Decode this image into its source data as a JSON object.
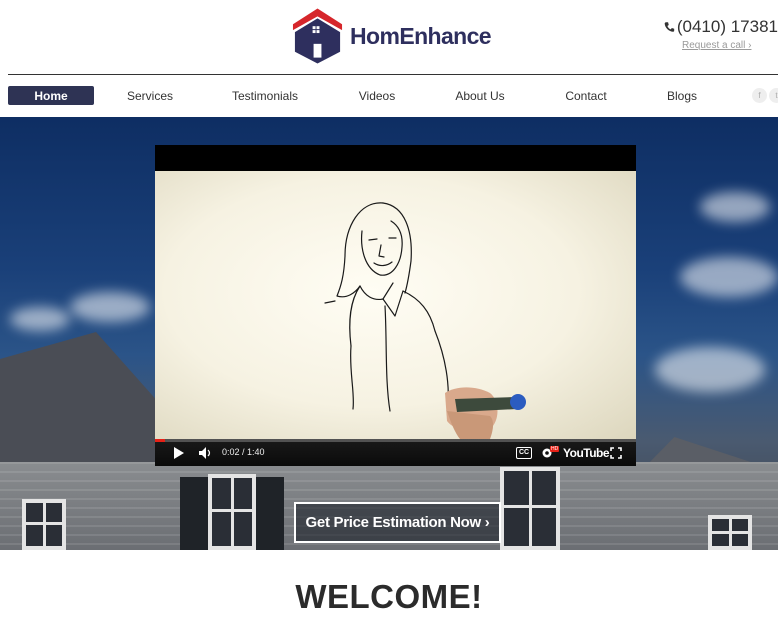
{
  "header": {
    "brand_name": "HomEnhance",
    "phone": "(0410) 17381",
    "request_call": "Request a call ›"
  },
  "nav": {
    "items": [
      {
        "label": "Home",
        "active": true
      },
      {
        "label": "Services"
      },
      {
        "label": "Testimonials"
      },
      {
        "label": "Videos"
      },
      {
        "label": "About Us"
      },
      {
        "label": "Contact"
      },
      {
        "label": "Blogs"
      }
    ],
    "social": [
      "f",
      "t"
    ]
  },
  "video": {
    "time": "0:02 / 1:40",
    "progress_fraction": 0.02,
    "cc_label": "CC",
    "brand": "YouTube",
    "hd_label": "HD"
  },
  "hero": {
    "cta_label": "Get Price Estimation Now ›"
  },
  "welcome": {
    "title": "WELCOME!"
  },
  "colors": {
    "brand_navy": "#2e3354",
    "logo_red": "#d6262b",
    "logo_navy": "#2e2f5e",
    "youtube_red": "#e62117"
  }
}
